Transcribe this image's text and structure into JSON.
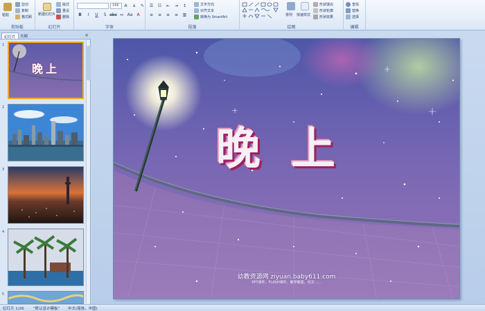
{
  "ribbon": {
    "clipboard": {
      "label": "剪贴板",
      "paste": "粘贴",
      "cut": "剪切",
      "copy": "复制",
      "format_painter": "格式刷"
    },
    "slides": {
      "label": "幻灯片",
      "new_slide": "新建幻灯片",
      "layout": "版式",
      "reset": "重设",
      "delete": "删除"
    },
    "font": {
      "label": "字体",
      "font_name": "",
      "font_size": "166"
    },
    "paragraph": {
      "label": "段落",
      "text_direction": "文字方向",
      "align_text": "对齐文本",
      "smartart": "转换为 SmartArt"
    },
    "drawing": {
      "label": "绘图",
      "arrange": "排列",
      "quick_styles": "快速样式",
      "shape_fill": "形状填充",
      "shape_outline": "形状轮廓",
      "shape_effects": "形状效果"
    },
    "editing": {
      "label": "编辑",
      "find": "查找",
      "replace": "替换",
      "select": "选择"
    }
  },
  "panel": {
    "tab_slides": "幻灯片",
    "tab_outline": "大纲",
    "thumbs": [
      {
        "num": "1",
        "title": "晚上"
      },
      {
        "num": "2"
      },
      {
        "num": "3"
      },
      {
        "num": "4"
      },
      {
        "num": "5"
      }
    ]
  },
  "slide": {
    "title": "晚上",
    "watermark": "幼教资源网 ziyuan.baby611.com",
    "watermark_sub": "PPT课件、FLASH课件、教学教案、论文……"
  },
  "status": {
    "slide_pos": "幻灯片 1/26",
    "theme": "\"默认设计模板\"",
    "language": "中文(简体，中国)"
  },
  "colors": {
    "ribbon": "#dbe7f6",
    "panel": "#dce7f5",
    "selected": "#f5a623"
  }
}
